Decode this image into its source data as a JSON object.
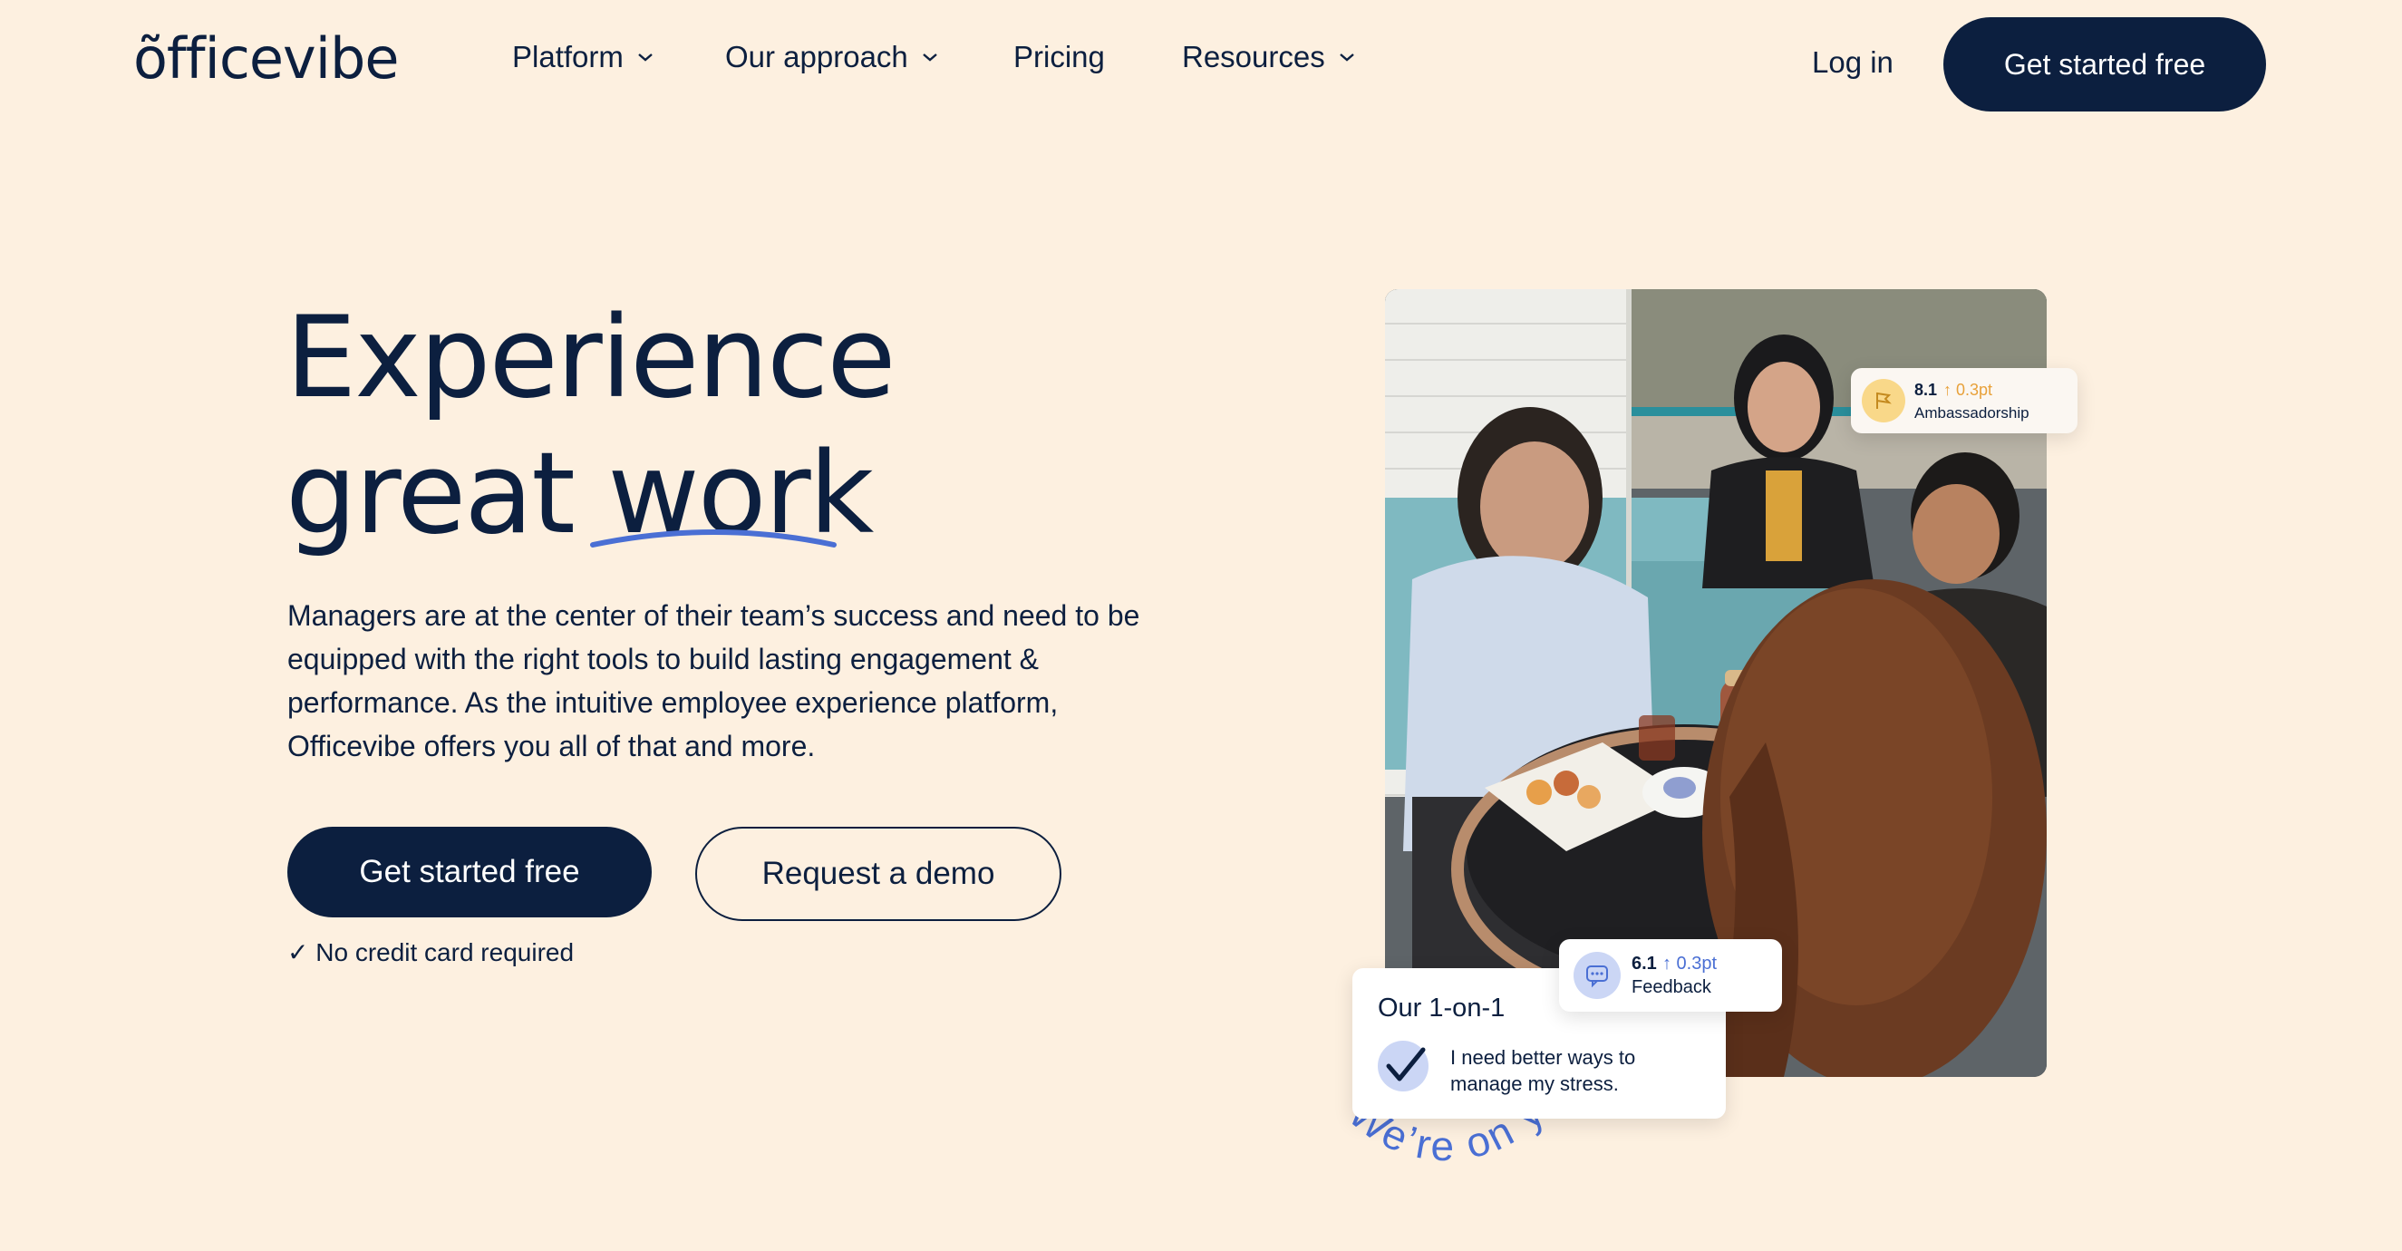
{
  "brand": {
    "logo_text": "õfficevibe"
  },
  "nav": {
    "items": [
      {
        "label": "Platform",
        "has_dropdown": true
      },
      {
        "label": "Our approach",
        "has_dropdown": true
      },
      {
        "label": "Pricing",
        "has_dropdown": false
      },
      {
        "label": "Resources",
        "has_dropdown": true
      }
    ],
    "login_label": "Log in",
    "cta_label": "Get started free"
  },
  "hero": {
    "title_line1": "Experience",
    "title_line2_a": "great",
    "title_line2_b": "work",
    "description": "Managers are at the center of their team’s success and need to be equipped with the right tools to build lasting engagement & performance. As the intuitive employee experience platform, Officevibe offers you all of that and more.",
    "primary_cta": "Get started free",
    "secondary_cta": "Request a demo",
    "note": "✓ No credit card required"
  },
  "visual": {
    "curved_text": "We’re on your vibe.",
    "ambassadorship_card": {
      "score": "8.1",
      "delta": "↑ 0.3pt",
      "label": "Ambassadorship"
    },
    "feedback_card": {
      "score": "6.1",
      "delta": "↑ 0.3pt",
      "label": "Feedback"
    },
    "one_on_one_card": {
      "title": "Our 1-on-1",
      "message": "I need better ways to manage my stress."
    }
  },
  "colors": {
    "background": "#fdf0e0",
    "navy": "#0c1f3f",
    "accent_blue": "#4a6fd4",
    "orange": "#e8a13a"
  }
}
